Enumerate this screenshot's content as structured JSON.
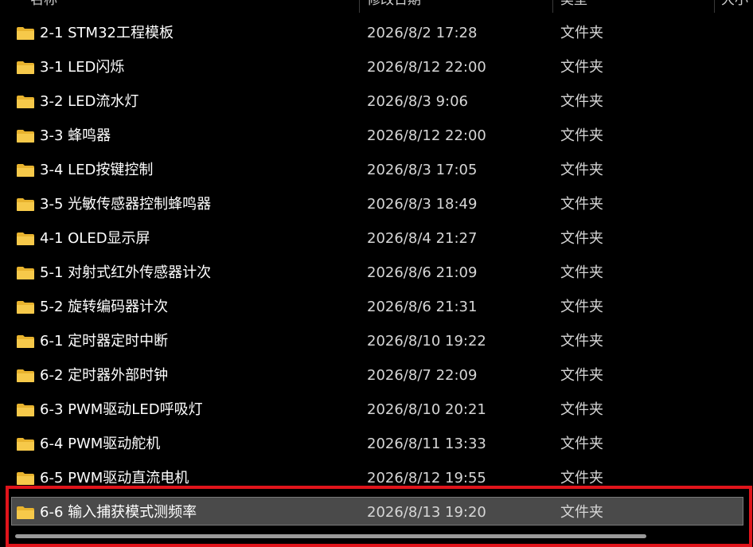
{
  "columns": {
    "name": "名称",
    "date": "修改日期",
    "type": "类型",
    "size": "大小"
  },
  "colors": {
    "background": "#000000",
    "folder": "#f4c542",
    "selection": "#4a4a4a",
    "annotation_box": "#e0141b"
  },
  "icon": "folder-icon",
  "files": [
    {
      "name": "2-1 STM32工程模板",
      "date": "2026/8/2 17:28",
      "type": "文件夹"
    },
    {
      "name": "3-1 LED闪烁",
      "date": "2026/8/12 22:00",
      "type": "文件夹"
    },
    {
      "name": "3-2 LED流水灯",
      "date": "2026/8/3 9:06",
      "type": "文件夹"
    },
    {
      "name": "3-3 蜂鸣器",
      "date": "2026/8/12 22:00",
      "type": "文件夹"
    },
    {
      "name": "3-4 LED按键控制",
      "date": "2026/8/3 17:05",
      "type": "文件夹"
    },
    {
      "name": "3-5 光敏传感器控制蜂鸣器",
      "date": "2026/8/3 18:49",
      "type": "文件夹"
    },
    {
      "name": "4-1 OLED显示屏",
      "date": "2026/8/4 21:27",
      "type": "文件夹"
    },
    {
      "name": "5-1 对射式红外传感器计次",
      "date": "2026/8/6 21:09",
      "type": "文件夹"
    },
    {
      "name": "5-2 旋转编码器计次",
      "date": "2026/8/6 21:31",
      "type": "文件夹"
    },
    {
      "name": "6-1 定时器定时中断",
      "date": "2026/8/10 19:22",
      "type": "文件夹"
    },
    {
      "name": "6-2 定时器外部时钟",
      "date": "2026/8/7 22:09",
      "type": "文件夹"
    },
    {
      "name": "6-3 PWM驱动LED呼吸灯",
      "date": "2026/8/10 20:21",
      "type": "文件夹"
    },
    {
      "name": "6-4 PWM驱动舵机",
      "date": "2026/8/11 13:33",
      "type": "文件夹"
    },
    {
      "name": "6-5 PWM驱动直流电机",
      "date": "2026/8/12 19:55",
      "type": "文件夹"
    },
    {
      "name": "6-6 输入捕获模式测频率",
      "date": "2026/8/13 19:20",
      "type": "文件夹",
      "selected": true
    }
  ]
}
